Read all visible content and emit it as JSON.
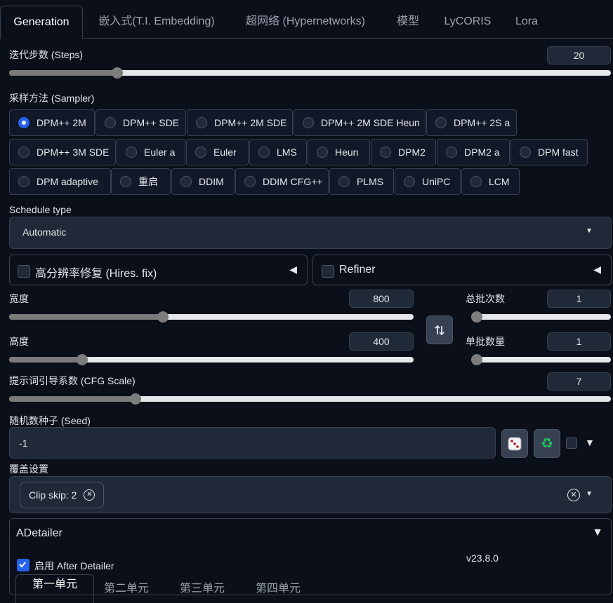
{
  "tabs": [
    "Generation",
    "嵌入式(T.I. Embedding)",
    "超网络 (Hypernetworks)",
    "模型",
    "LyCORIS",
    "Lora"
  ],
  "steps": {
    "label": "迭代步数 (Steps)",
    "value": "20",
    "level": 0.18
  },
  "sampler": {
    "label": "采样方法 (Sampler)",
    "options": [
      "DPM++ 2M",
      "DPM++ SDE",
      "DPM++ 2M SDE",
      "DPM++ 2M SDE Heun",
      "DPM++ 2S a",
      "DPM++ 3M SDE",
      "Euler a",
      "Euler",
      "LMS",
      "Heun",
      "DPM2",
      "DPM2 a",
      "DPM fast",
      "DPM adaptive",
      "重启",
      "DDIM",
      "DDIM CFG++",
      "PLMS",
      "UniPC",
      "LCM"
    ],
    "selected": "DPM++ 2M"
  },
  "schedule": {
    "label": "Schedule type",
    "value": "Automatic"
  },
  "hires": {
    "label": "高分辨率修复 (Hires. fix)"
  },
  "refiner": {
    "label": "Refiner"
  },
  "width": {
    "label": "宽度",
    "value": "800",
    "level": 0.38
  },
  "height": {
    "label": "高度",
    "value": "400",
    "level": 0.18
  },
  "batch_count": {
    "label": "总批次数",
    "value": "1",
    "level": 0.0
  },
  "batch_size": {
    "label": "单批数量",
    "value": "1",
    "level": 0.0
  },
  "cfg": {
    "label": "提示词引导系数 (CFG Scale)",
    "value": "7",
    "level": 0.21
  },
  "seed": {
    "label": "随机数种子 (Seed)",
    "value": "-1"
  },
  "override": {
    "label": "覆盖设置",
    "chip": "Clip skip: 2"
  },
  "adetailer": {
    "title": "ADetailer",
    "enable_label": "启用 After Detailer",
    "version": "v23.8.0",
    "subtabs": [
      "第一单元",
      "第二单元",
      "第三单元",
      "第四单元"
    ]
  },
  "colors": {
    "accent": "#2563eb",
    "background": "#0b0f19",
    "border": "#374151"
  }
}
